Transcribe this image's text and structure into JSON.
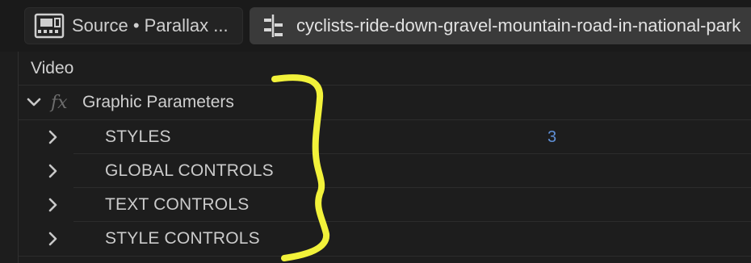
{
  "tabs": [
    {
      "label": "Source • Parallax ...",
      "icon": "film-icon"
    },
    {
      "label": "cyclists-ride-down-gravel-mountain-road-in-national-park",
      "icon": "effects-controls-icon"
    }
  ],
  "panel": {
    "section_label": "Video",
    "effect": {
      "fx_symbol": "fx",
      "name": "Graphic Parameters"
    },
    "groups": [
      {
        "label": "STYLES",
        "value": "3"
      },
      {
        "label": "GLOBAL CONTROLS",
        "value": ""
      },
      {
        "label": "TEXT CONTROLS",
        "value": ""
      },
      {
        "label": "STYLE CONTROLS",
        "value": ""
      }
    ]
  },
  "annotation": {
    "color": "#f5f542",
    "shape": "curly-bracket"
  },
  "colors": {
    "value_blue": "#5f8fd6",
    "background": "#1d1d1d"
  }
}
